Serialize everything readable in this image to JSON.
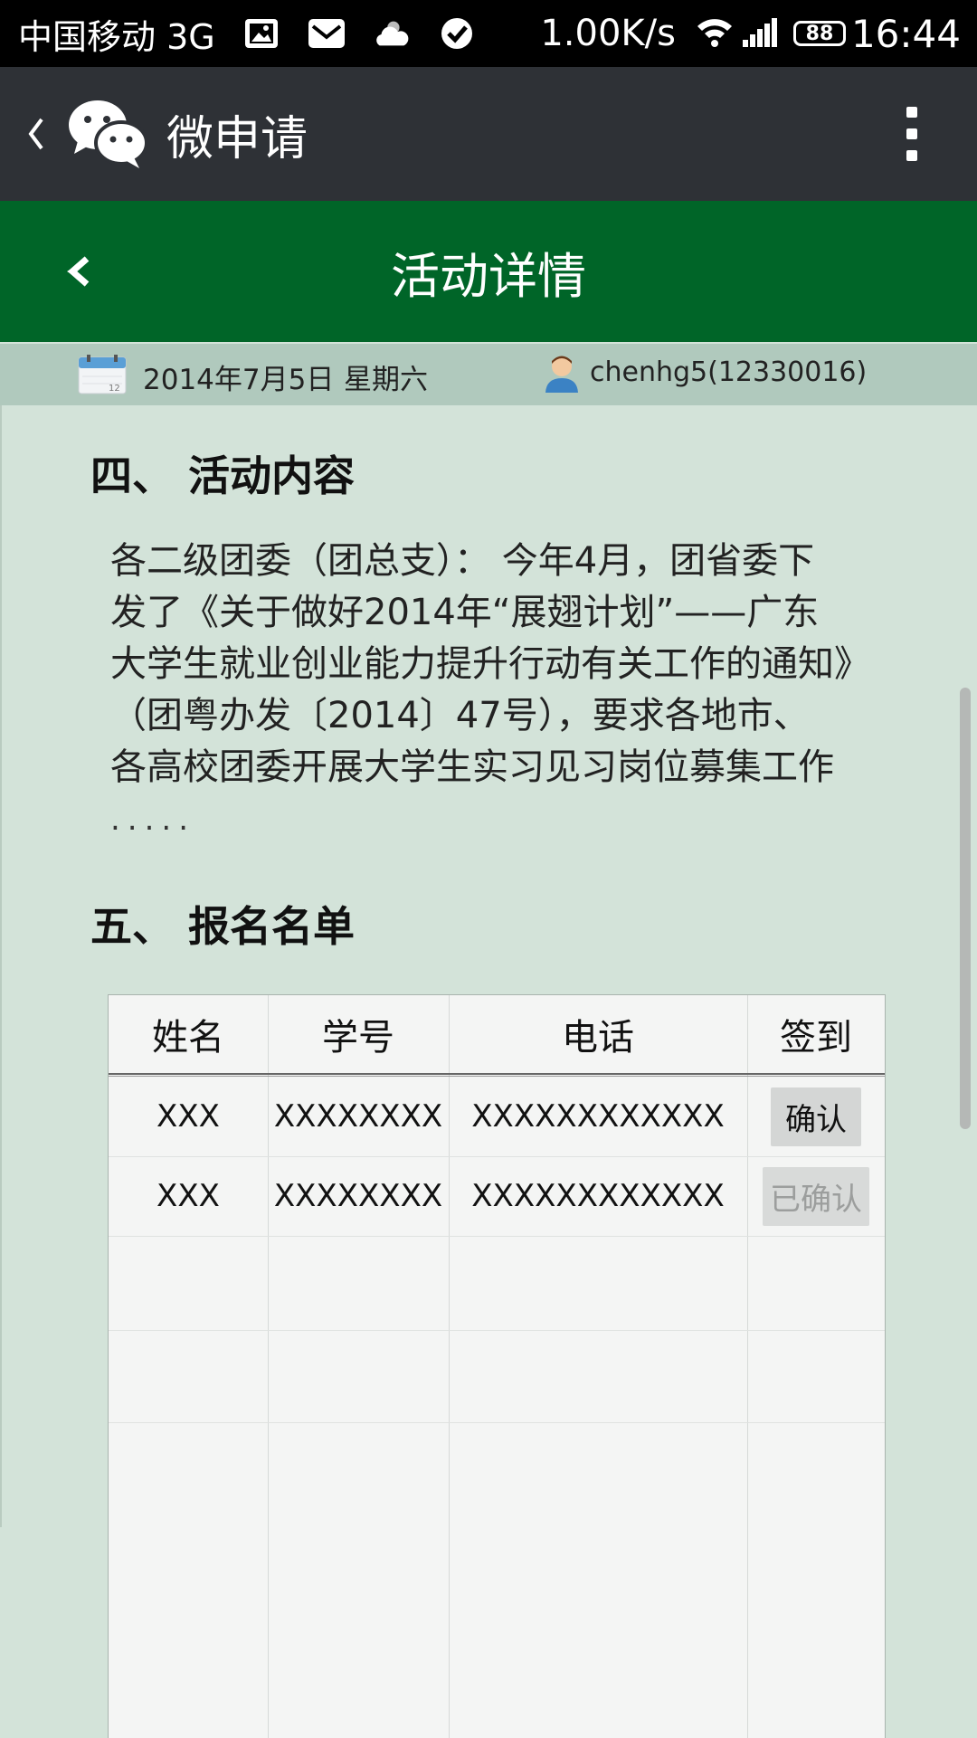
{
  "status_bar": {
    "carrier": "中国移动 3G",
    "speed": "1.00K/s",
    "battery": "88",
    "time": "16:44",
    "icons": [
      "image-icon",
      "mail-icon",
      "weather-icon",
      "check-icon",
      "wifi-icon",
      "signal-icon",
      "battery-icon"
    ]
  },
  "wechat_bar": {
    "title": "微申请",
    "icons": [
      "back-chevron-icon",
      "wechat-logo-icon",
      "more-icon"
    ]
  },
  "header": {
    "title": "活动详情",
    "back_icon": "arrow-left-icon",
    "color": "#006528"
  },
  "info": {
    "date": "2014年7月5日",
    "weekday": "星期六",
    "user": "chenhg5(12330016)",
    "icons": [
      "calendar-icon",
      "user-icon"
    ]
  },
  "section4": {
    "title": "四、 活动内容",
    "lines": [
      "各二级团委（团总支）：  今年4月，团省委下",
      "发了《关于做好2014年“展翅计划”——广东",
      "大学生就业创业能力提升行动有关工作的通知》",
      "（团粤办发〔2014〕47号），要求各地市、",
      "各高校团委开展大学生实习见习岗位募集工作"
    ],
    "ellipsis": "....."
  },
  "section5": {
    "title": "五、 报名名单"
  },
  "table": {
    "headers": [
      "姓名",
      "学号",
      "电话",
      "签到"
    ],
    "rows": [
      {
        "name": "XXX",
        "id": "XXXXXXXX",
        "phone": "XXXXXXXXXXXX",
        "action": "确认",
        "confirmed": false
      },
      {
        "name": "XXX",
        "id": "XXXXXXXX",
        "phone": "XXXXXXXXXXXX",
        "action": "已确认",
        "confirmed": true
      }
    ]
  },
  "colors": {
    "page_bg": "#d3e3d9",
    "wechat_bar": "#2e3136",
    "info_strip": "#b0c9bd"
  }
}
